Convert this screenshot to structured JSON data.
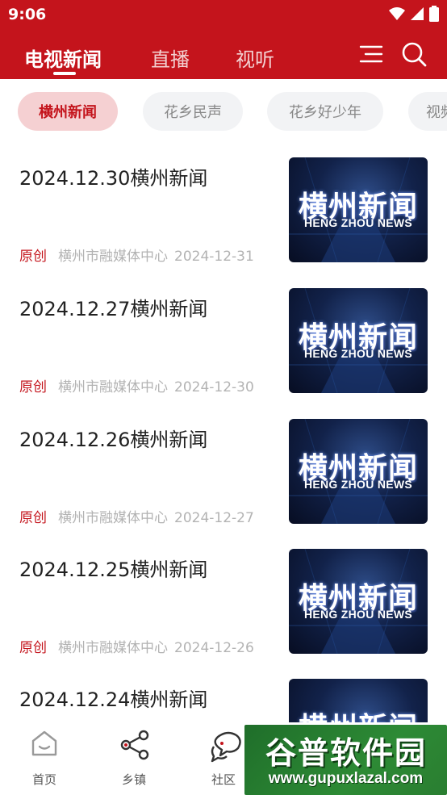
{
  "status_bar": {
    "time": "9:06"
  },
  "header": {
    "tabs": [
      {
        "label": "电视新闻",
        "active": true
      },
      {
        "label": "直播",
        "active": false
      },
      {
        "label": "视听",
        "active": false
      }
    ],
    "icons": [
      "menu-icon",
      "search-icon"
    ]
  },
  "chips": [
    {
      "label": "横州新闻",
      "active": true
    },
    {
      "label": "花乡民声",
      "active": false
    },
    {
      "label": "花乡好少年",
      "active": false
    },
    {
      "label": "视频",
      "active": false
    }
  ],
  "news": [
    {
      "title": "2024.12.30横州新闻",
      "tag": "原创",
      "source": "横州市融媒体中心",
      "date": "2024-12-31",
      "thumb_cn": "横州新闻",
      "thumb_en": "HENG ZHOU NEWS"
    },
    {
      "title": "2024.12.27横州新闻",
      "tag": "原创",
      "source": "横州市融媒体中心",
      "date": "2024-12-30",
      "thumb_cn": "横州新闻",
      "thumb_en": "HENG ZHOU NEWS"
    },
    {
      "title": "2024.12.26横州新闻",
      "tag": "原创",
      "source": "横州市融媒体中心",
      "date": "2024-12-27",
      "thumb_cn": "横州新闻",
      "thumb_en": "HENG ZHOU NEWS"
    },
    {
      "title": "2024.12.25横州新闻",
      "tag": "原创",
      "source": "横州市融媒体中心",
      "date": "2024-12-26",
      "thumb_cn": "横州新闻",
      "thumb_en": "HENG ZHOU NEWS"
    },
    {
      "title": "2024.12.24横州新闻",
      "thumb_cn": "横州新闻"
    }
  ],
  "bottom_nav": [
    {
      "label": "首页",
      "icon": "home-icon"
    },
    {
      "label": "乡镇",
      "icon": "share-icon"
    },
    {
      "label": "社区",
      "icon": "chat-icon"
    }
  ],
  "watermark": {
    "line1": "谷普软件园",
    "line2": "www.gupuxlazal.com"
  },
  "colors": {
    "primary": "#c4141c",
    "chip_active_bg": "#f5d0d2",
    "chip_bg": "#f2f3f5",
    "meta": "#b3b3b3"
  }
}
